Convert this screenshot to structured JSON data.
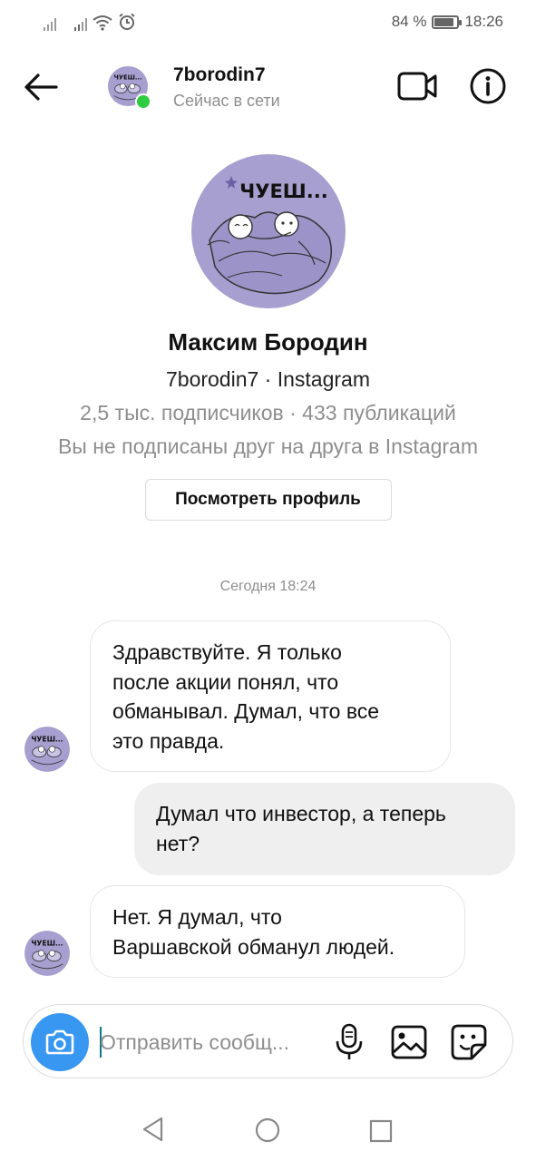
{
  "status_bar": {
    "battery_text": "84 %",
    "battery_level": 0.84,
    "time": "18:26",
    "icons": [
      "signal-icon",
      "signal-icon",
      "wifi-icon",
      "alarm-icon",
      "battery-icon"
    ]
  },
  "header": {
    "username": "7borodin7",
    "presence": "Сейчас в сети",
    "online_color": "#2ecc40"
  },
  "avatar": {
    "caption": "ЧУЕШ...",
    "bg_color": "#a79fcf"
  },
  "profile": {
    "full_name": "Максим Бородин",
    "handle_line": "7borodin7 · Instagram",
    "stats_line": "2,5 тыс. подписчиков · 433 публикаций",
    "relation_line": "Вы не подписаны друг на друга в Instagram",
    "view_profile_label": "Посмотреть профиль"
  },
  "date_separator": "Сегодня 18:24",
  "messages": [
    {
      "direction": "incoming",
      "lines": [
        "Здравствуйте. Я только",
        "после акции понял, что",
        "обманывал. Думал, что все",
        "это правда."
      ]
    },
    {
      "direction": "outgoing",
      "lines": [
        "Думал что инвестор, а теперь",
        "нет?"
      ]
    },
    {
      "direction": "incoming",
      "lines": [
        "Нет. Я думал, что",
        "Варшавской обманул людей."
      ]
    }
  ],
  "composer": {
    "placeholder": "Отправить сообщ...",
    "accent_color": "#3897f0"
  },
  "nav_bar": {
    "icons": [
      "nav-back-icon",
      "nav-home-icon",
      "nav-recent-icon"
    ]
  }
}
